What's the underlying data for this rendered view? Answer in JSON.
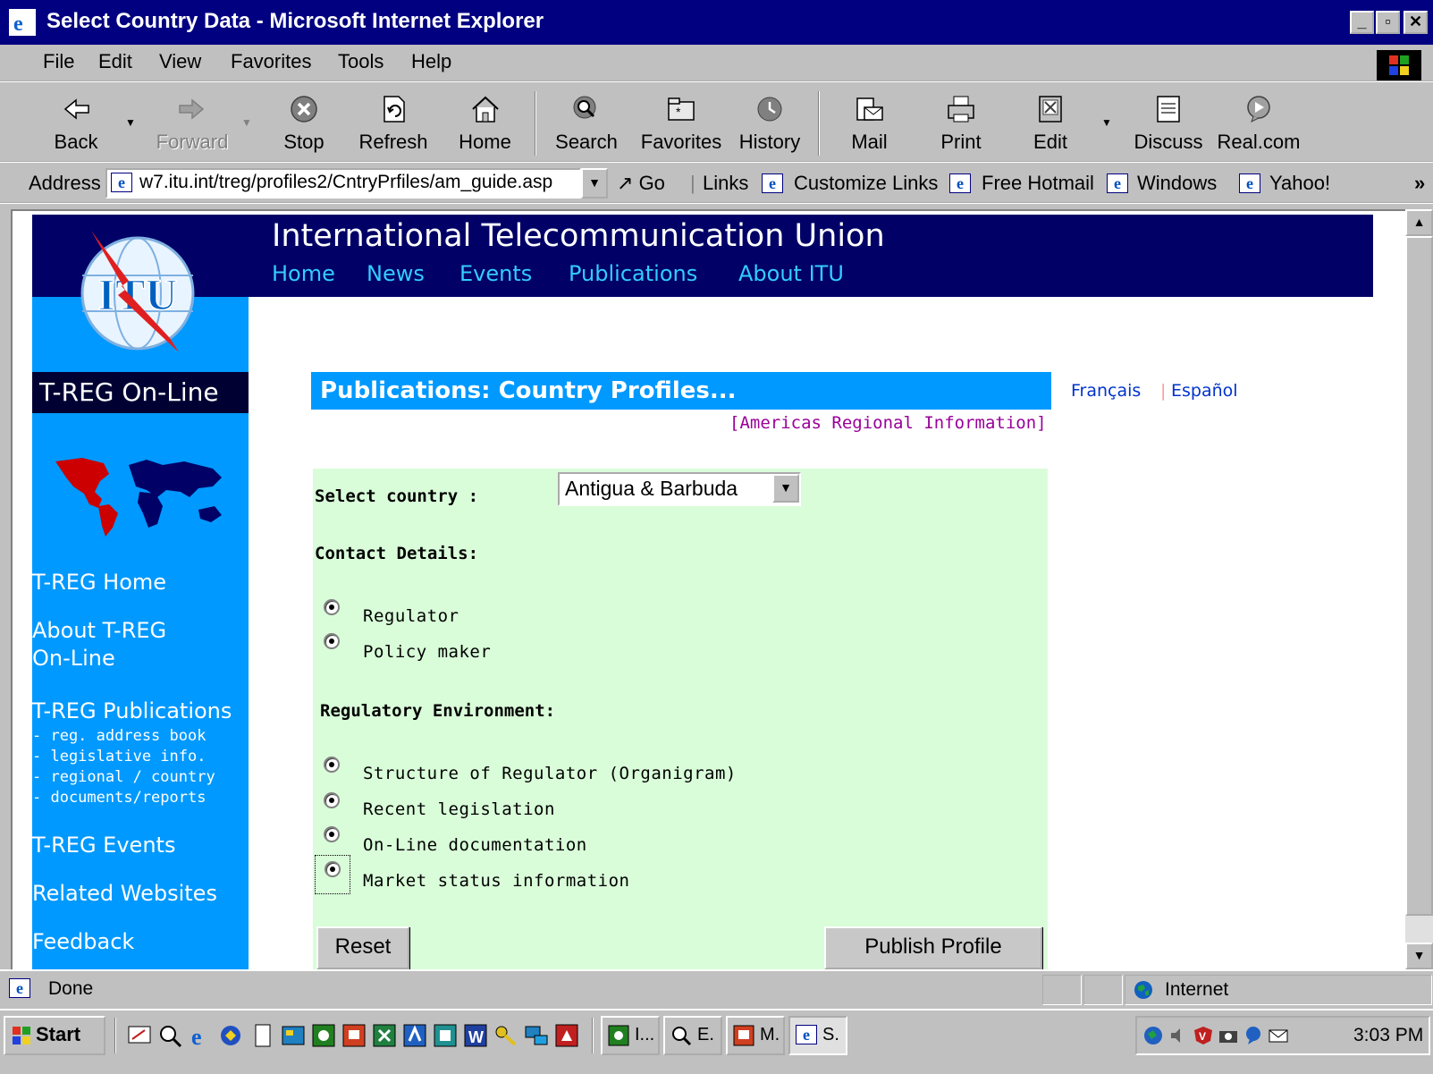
{
  "window": {
    "title": "Select Country Data - Microsoft Internet Explorer"
  },
  "menu": [
    "File",
    "Edit",
    "View",
    "Favorites",
    "Tools",
    "Help"
  ],
  "toolbar": {
    "back": "Back",
    "forward": "Forward",
    "stop": "Stop",
    "refresh": "Refresh",
    "home": "Home",
    "search": "Search",
    "favorites": "Favorites",
    "history": "History",
    "mail": "Mail",
    "print": "Print",
    "edit": "Edit",
    "discuss": "Discuss",
    "real": "Real.com"
  },
  "address": {
    "label": "Address",
    "url": "w7.itu.int/treg/profiles2/CntryPrfiles/am_guide.asp",
    "go": "Go",
    "links_label": "Links",
    "links": [
      "Customize Links",
      "Free Hotmail",
      "Windows",
      "Yahoo!"
    ],
    "more": "»"
  },
  "page": {
    "org": "International Telecommunication Union",
    "topnav": [
      "Home",
      "News",
      "Events",
      "Publications",
      "About ITU"
    ],
    "logo_text": "ITU",
    "sidebar_title": "T-REG On-Line",
    "sidebar_links": {
      "home": "T-REG Home",
      "about1": "About T-REG",
      "about2": "On-Line",
      "publications": "T-REG Publications",
      "sub": [
        "- reg. address book",
        "- legislative info.",
        "- regional / country",
        "- documents/reports"
      ],
      "events": "T-REG Events",
      "related": "Related Websites",
      "feedback": "Feedback"
    },
    "pub_title": "Publications: Country Profiles...",
    "lang": {
      "fr": "Français",
      "sep": "|",
      "es": "Español"
    },
    "americas": "[Americas Regional Information]",
    "form": {
      "select_label": "Select country :",
      "country": "Antigua & Barbuda",
      "contact_heading": "Contact Details:",
      "contact_options": [
        "Regulator",
        "Policy maker"
      ],
      "reg_heading": "Regulatory Environment:",
      "reg_options": [
        "Structure of Regulator (Organigram)",
        "Recent legislation",
        "On-Line documentation",
        "Market status information"
      ],
      "reset": "Reset",
      "publish": "Publish Profile"
    }
  },
  "status": {
    "left": "Done",
    "zone": "Internet"
  },
  "taskbar": {
    "start": "Start",
    "tasks": [
      "I...",
      "E.",
      "M.",
      "S."
    ],
    "clock": "3:03 PM"
  }
}
